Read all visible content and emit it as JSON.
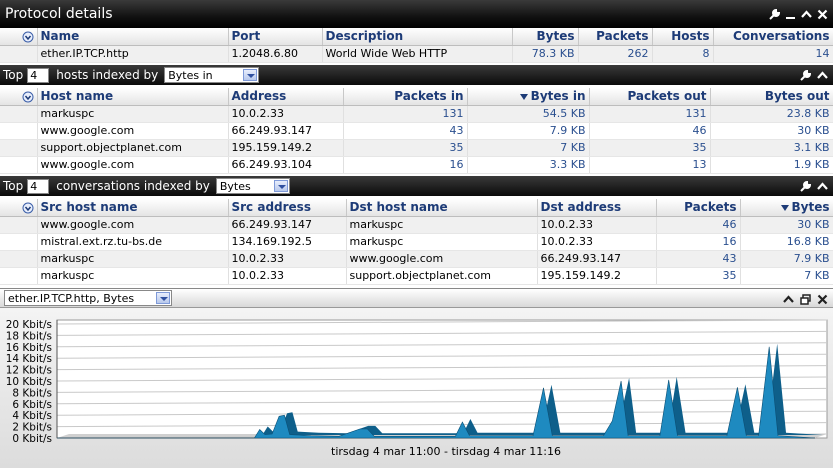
{
  "protocol_panel": {
    "title": "Protocol details",
    "columns": [
      "Name",
      "Port",
      "Description",
      "Bytes",
      "Packets",
      "Hosts",
      "Conversations"
    ],
    "rows": [
      [
        "ether.IP.TCP.http",
        "1.2048.6.80",
        "World Wide Web HTTP",
        "78.3 KB",
        "262",
        "8",
        "14"
      ]
    ]
  },
  "hosts_panel": {
    "top_label": "Top",
    "top_value": "4",
    "indexed_label": "hosts indexed by",
    "index_selected": "Bytes in",
    "columns": [
      "Host name",
      "Address",
      "Packets in",
      "Bytes in",
      "Packets out",
      "Bytes out"
    ],
    "rows": [
      [
        "markuspc",
        "10.0.2.33",
        "131",
        "54.5 KB",
        "131",
        "23.8 KB"
      ],
      [
        "www.google.com",
        "66.249.93.147",
        "43",
        "7.9 KB",
        "46",
        "30 KB"
      ],
      [
        "support.objectplanet.com",
        "195.159.149.2",
        "35",
        "7 KB",
        "35",
        "3.1 KB"
      ],
      [
        "www.google.com",
        "66.249.93.104",
        "16",
        "3.3 KB",
        "13",
        "1.9 KB"
      ]
    ]
  },
  "conv_panel": {
    "top_label": "Top",
    "top_value": "4",
    "indexed_label": "conversations indexed by",
    "index_selected": "Bytes",
    "columns": [
      "Src host name",
      "Src address",
      "Dst host name",
      "Dst address",
      "Packets",
      "Bytes"
    ],
    "rows": [
      [
        "www.google.com",
        "66.249.93.147",
        "markuspc",
        "10.0.2.33",
        "46",
        "30 KB"
      ],
      [
        "mistral.ext.rz.tu-bs.de",
        "134.169.192.5",
        "markuspc",
        "10.0.2.33",
        "16",
        "16.8 KB"
      ],
      [
        "markuspc",
        "10.0.2.33",
        "www.google.com",
        "66.249.93.147",
        "43",
        "7.9 KB"
      ],
      [
        "markuspc",
        "10.0.2.33",
        "support.objectplanet.com",
        "195.159.149.2",
        "35",
        "7 KB"
      ]
    ]
  },
  "chart_panel": {
    "selector": "ether.IP.TCP.http, Bytes"
  },
  "colors": {
    "accent": "#1d3b77",
    "series": "#1e8ac0"
  },
  "chart_data": {
    "type": "area",
    "title": "",
    "xlabel": "tirsdag 4 mar 11:00 - tirsdag 4 mar 11:16",
    "ylabel": "",
    "y_ticks": [
      "0 Kbit/s",
      "2 Kbit/s",
      "4 Kbit/s",
      "6 Kbit/s",
      "8 Kbit/s",
      "10 Kbit/s",
      "12 Kbit/s",
      "14 Kbit/s",
      "16 Kbit/s",
      "18 Kbit/s",
      "20 Kbit/s"
    ],
    "ylim": [
      0,
      20
    ],
    "x_range_minutes": [
      0,
      16
    ],
    "series": [
      {
        "values": [
          [
            0,
            0
          ],
          [
            5.6,
            0
          ],
          [
            5.75,
            1.5
          ],
          [
            5.9,
            0.6
          ],
          [
            6.1,
            0.7
          ],
          [
            6.3,
            3.8
          ],
          [
            6.45,
            4.0
          ],
          [
            6.6,
            0.6
          ],
          [
            7.2,
            0.4
          ],
          [
            8.0,
            0.3
          ],
          [
            8.6,
            1.6
          ],
          [
            8.8,
            1.6
          ],
          [
            9.0,
            0.3
          ],
          [
            10.0,
            0.3
          ],
          [
            11.3,
            0.3
          ],
          [
            11.5,
            2.8
          ],
          [
            11.7,
            0.4
          ],
          [
            13.5,
            0.4
          ],
          [
            13.8,
            8.8
          ],
          [
            14.05,
            0.4
          ],
          [
            15.5,
            0.4
          ],
          [
            15.75,
            3.0
          ],
          [
            16.0,
            10.0
          ],
          [
            16.2,
            0.4
          ],
          [
            17.1,
            0.4
          ],
          [
            17.35,
            10.2
          ],
          [
            17.6,
            0.4
          ],
          [
            19.0,
            0.4
          ],
          [
            19.3,
            8.9
          ],
          [
            19.55,
            0.4
          ],
          [
            19.9,
            0.4
          ],
          [
            20.2,
            16.0
          ],
          [
            20.45,
            0.4
          ],
          [
            21.5,
            0
          ]
        ]
      }
    ],
    "grid": true,
    "legend": "none"
  }
}
